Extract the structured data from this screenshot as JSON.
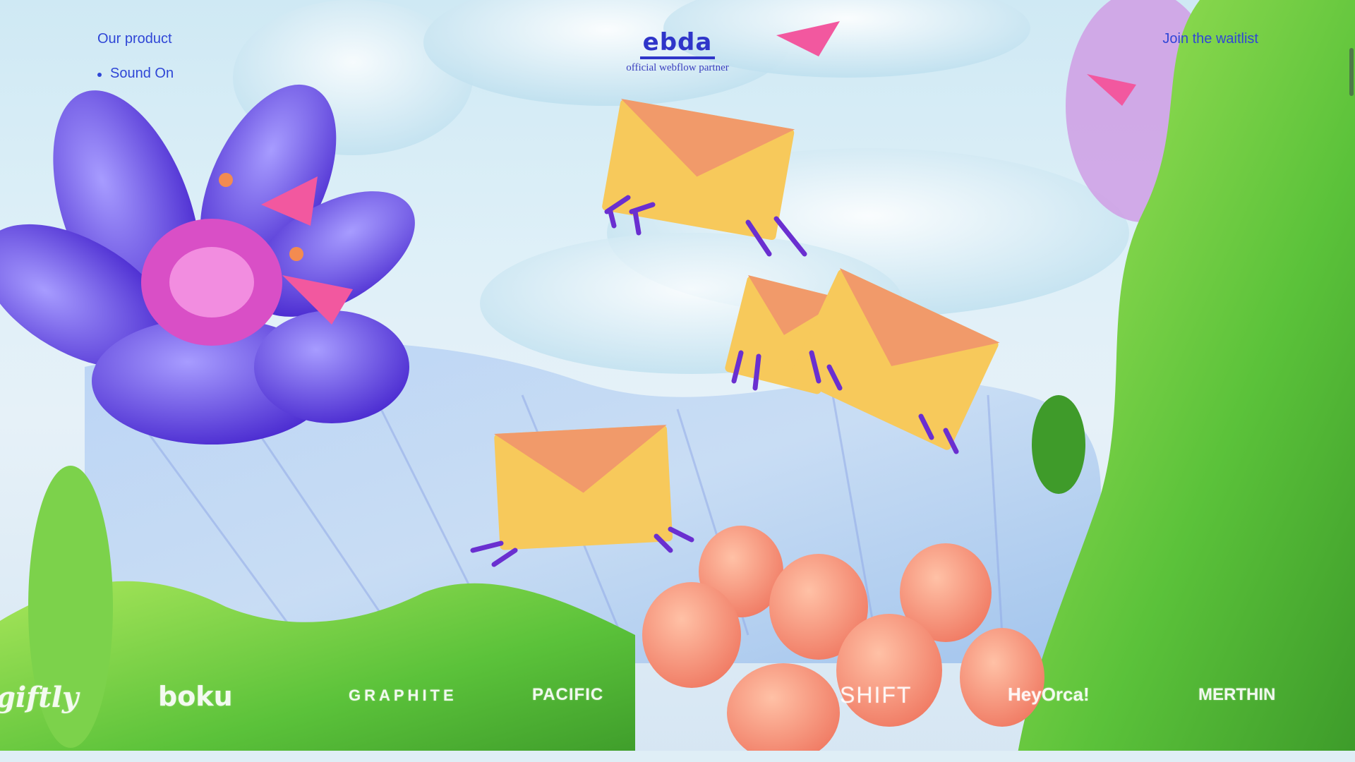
{
  "nav": {
    "our_product": "Our product",
    "items": [
      {
        "label": "Sound On"
      }
    ],
    "waitlist": "Join the waitlist"
  },
  "brand": {
    "logo_text": "ebda",
    "subtitle": "official webflow partner"
  },
  "logos": [
    "giftly",
    "boku",
    "GRAPHITE",
    "PACIFIC",
    "SHIFT",
    "HeyOrca!",
    "MERTHIN"
  ],
  "colors": {
    "nav_text": "#2f46d6",
    "brand": "#2f35c9",
    "envelope": "#f7c95b",
    "envelope_flap": "#f19a6a"
  }
}
